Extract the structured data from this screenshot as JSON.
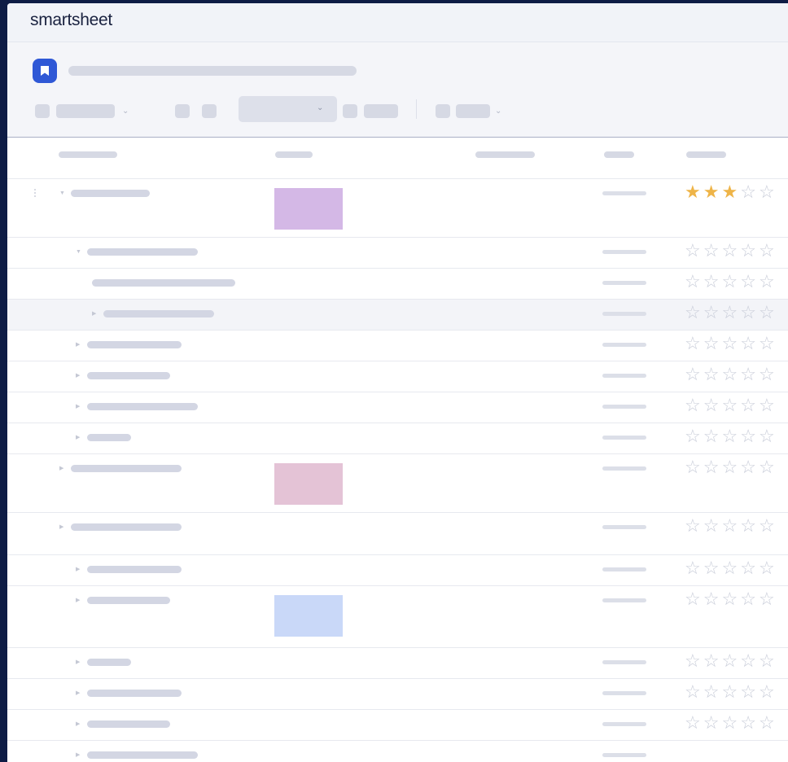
{
  "app": {
    "name": "smartsheet"
  },
  "colors": {
    "accent": "#2f58d6",
    "star_filled": "#eeb448",
    "star_empty": "#c9cdd9",
    "swatch_purple": "#d4b8e6",
    "swatch_pink": "#e4c3d6",
    "swatch_blue": "#c9d8f8"
  },
  "icons": {
    "sheet": "bookmark-icon",
    "expand": "triangle-icon",
    "dropdown": "chevron-down-icon",
    "rating": "star-icon",
    "drag": "drag-handle-icon"
  },
  "rows": [
    {
      "level": 0,
      "expanded": true,
      "rating": 3,
      "swatch": "purple"
    },
    {
      "level": 1,
      "expanded": true,
      "rating": 0
    },
    {
      "level": 2,
      "expanded": null,
      "rating": 0
    },
    {
      "level": 2,
      "expanded": false,
      "rating": 0,
      "selected": true
    },
    {
      "level": 1,
      "expanded": false,
      "rating": 0
    },
    {
      "level": 1,
      "expanded": false,
      "rating": 0
    },
    {
      "level": 1,
      "expanded": false,
      "rating": 0
    },
    {
      "level": 1,
      "expanded": false,
      "rating": 0
    },
    {
      "level": 0,
      "expanded": false,
      "rating": 0,
      "swatch": "pink"
    },
    {
      "level": 0,
      "expanded": false,
      "rating": 0
    },
    {
      "level": 1,
      "expanded": false,
      "rating": 0
    },
    {
      "level": 1,
      "expanded": false,
      "rating": 0,
      "swatch": "blue"
    },
    {
      "level": 1,
      "expanded": false,
      "rating": 0
    },
    {
      "level": 1,
      "expanded": false,
      "rating": 0
    },
    {
      "level": 1,
      "expanded": false,
      "rating": 0
    },
    {
      "level": 1,
      "expanded": false,
      "rating": null
    }
  ],
  "rating_max": 5
}
